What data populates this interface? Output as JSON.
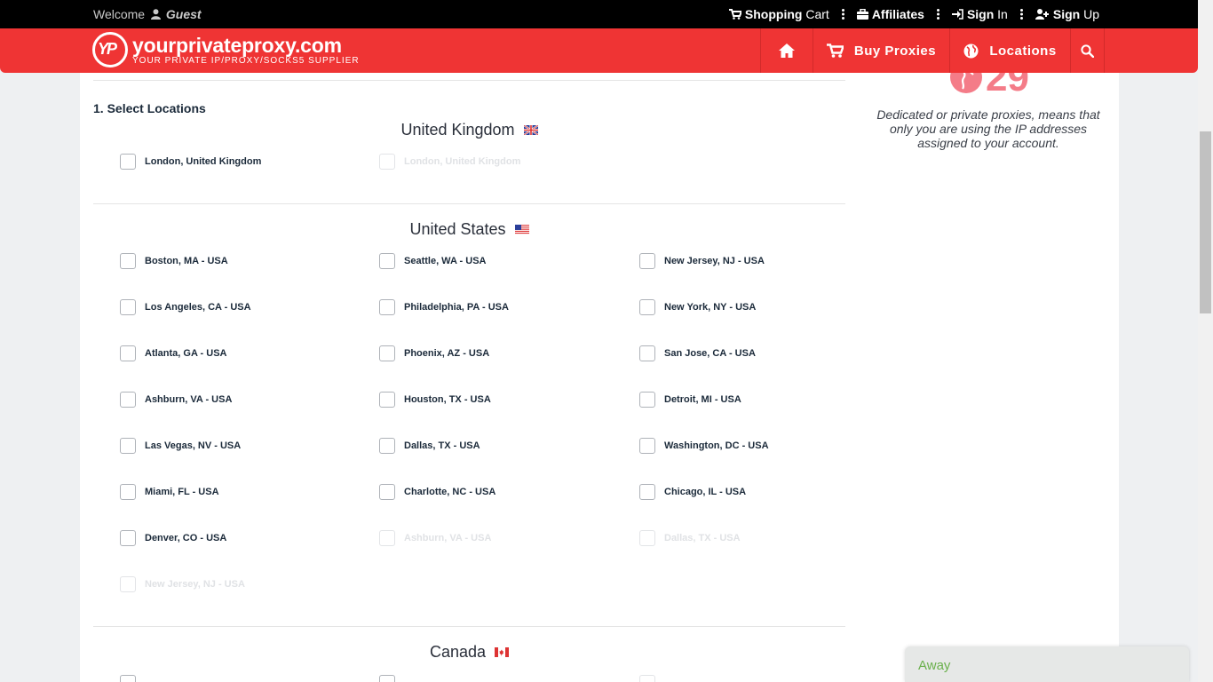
{
  "topbar": {
    "welcome": "Welcome",
    "user": "Guest",
    "shopping_cart_bold": "Shopping",
    "shopping_cart_rest": "Cart",
    "affiliates": "Affiliates",
    "sign_in_bold": "Sign",
    "sign_in_rest": "In",
    "sign_up_bold": "Sign",
    "sign_up_rest": "Up"
  },
  "header": {
    "logo_name": "yourprivateproxy.com",
    "logo_tagline": "YOUR PRIVATE IP/PROXY/SOCKS5 SUPPLIER",
    "nav_buy": "Buy Proxies",
    "nav_locations": "Locations",
    "accent_color": "#ef3434"
  },
  "main": {
    "section_title": "1. Select Locations",
    "countries": [
      {
        "name": "United Kingdom",
        "locations": [
          {
            "label": "London, United Kingdom",
            "enabled": true
          },
          {
            "label": "London, United Kingdom",
            "enabled": false
          }
        ]
      },
      {
        "name": "United States",
        "locations": [
          {
            "label": "Boston, MA - USA",
            "enabled": true
          },
          {
            "label": "Seattle, WA - USA",
            "enabled": true
          },
          {
            "label": "New Jersey, NJ - USA",
            "enabled": true
          },
          {
            "label": "Los Angeles, CA - USA",
            "enabled": true
          },
          {
            "label": "Philadelphia, PA - USA",
            "enabled": true
          },
          {
            "label": "New York, NY - USA",
            "enabled": true
          },
          {
            "label": "Atlanta, GA - USA",
            "enabled": true
          },
          {
            "label": "Phoenix, AZ - USA",
            "enabled": true
          },
          {
            "label": "San Jose, CA - USA",
            "enabled": true
          },
          {
            "label": "Ashburn, VA - USA",
            "enabled": true
          },
          {
            "label": "Houston, TX - USA",
            "enabled": true
          },
          {
            "label": "Detroit, MI - USA",
            "enabled": true
          },
          {
            "label": "Las Vegas, NV - USA",
            "enabled": true
          },
          {
            "label": "Dallas, TX - USA",
            "enabled": true
          },
          {
            "label": "Washington, DC - USA",
            "enabled": true
          },
          {
            "label": "Miami, FL - USA",
            "enabled": true
          },
          {
            "label": "Charlotte, NC - USA",
            "enabled": true
          },
          {
            "label": "Chicago, IL - USA",
            "enabled": true
          },
          {
            "label": "Denver, CO - USA",
            "enabled": true
          },
          {
            "label": "Ashburn, VA - USA",
            "enabled": false
          },
          {
            "label": "Dallas, TX - USA",
            "enabled": false
          },
          {
            "label": "New Jersey, NJ - USA",
            "enabled": false
          }
        ]
      },
      {
        "name": "Canada",
        "locations": []
      }
    ]
  },
  "sidebar": {
    "count": "29",
    "description": "Dedicated or private proxies, means that only you are using the IP addresses assigned to your account."
  },
  "chat": {
    "status": "Away"
  }
}
